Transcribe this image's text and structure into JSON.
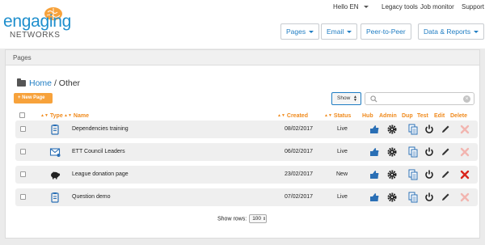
{
  "brand": {
    "line1": "engaging",
    "line2": "NETWORKS",
    "accent": "#1f8fcd",
    "brain_color": "#f7a23b"
  },
  "topnav": {
    "greeting": "Hello EN",
    "legacy": "Legacy tools",
    "job_monitor": "Job monitor",
    "support": "Support"
  },
  "mainnav": {
    "pages": "Pages",
    "email": "Email",
    "p2p": "Peer-to-Peer",
    "data_reports": "Data & Reports"
  },
  "panel": {
    "title": "Pages"
  },
  "breadcrumb": {
    "home": "Home",
    "separator": "/",
    "current": "Other"
  },
  "toolbar": {
    "new_page": "+ New Page",
    "show_label": "Show",
    "search_placeholder": ""
  },
  "table": {
    "headers": {
      "type": "Type",
      "name": "Name",
      "created": "Created",
      "status": "Status",
      "hub": "Hub",
      "admin": "Admin",
      "dup": "Dup",
      "test": "Test",
      "edit": "Edit",
      "delete": "Delete"
    },
    "rows": [
      {
        "type_icon": "clipboard-icon",
        "name": "Dependencies training",
        "created": "08/02/2017",
        "status": "Live",
        "can_delete": false
      },
      {
        "type_icon": "envelope-icon",
        "name": "ETT Council Leaders",
        "created": "06/02/2017",
        "status": "Live",
        "can_delete": false
      },
      {
        "type_icon": "piggy-bank-icon",
        "name": "League donation page",
        "created": "23/02/2017",
        "status": "New",
        "can_delete": true
      },
      {
        "type_icon": "clipboard-icon",
        "name": "Question demo",
        "created": "07/02/2017",
        "status": "Live",
        "can_delete": false
      }
    ]
  },
  "footer": {
    "show_rows_label": "Show rows:",
    "show_rows_value": "100"
  },
  "colors": {
    "orange": "#f08a1c",
    "blue": "#1f7dc3",
    "delete_active": "#d9251c",
    "delete_disabled": "#f2b5b0"
  }
}
